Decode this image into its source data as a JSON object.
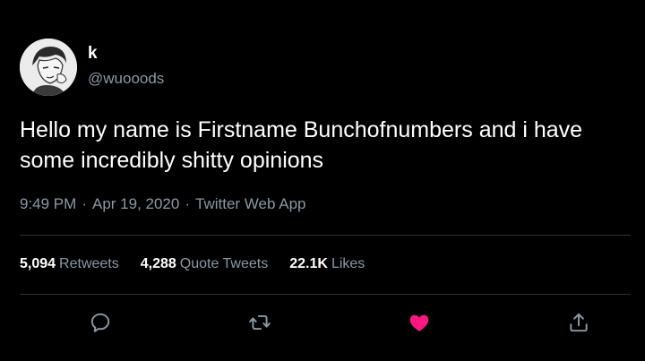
{
  "user": {
    "display_name": "k",
    "handle": "@wuooods"
  },
  "tweet": {
    "text": "Hello my name is Firstname Bunchofnumbers and i have some incredibly shitty opinions",
    "time": "9:49 PM",
    "date": "Apr 19, 2020",
    "source": "Twitter Web App",
    "separator": "·"
  },
  "stats": {
    "retweets_count": "5,094",
    "retweets_label": "Retweets",
    "quotes_count": "4,288",
    "quotes_label": "Quote Tweets",
    "likes_count": "22.1K",
    "likes_label": "Likes"
  },
  "actions": [
    {
      "icon": "reply-icon"
    },
    {
      "icon": "retweet-icon"
    },
    {
      "icon": "heart-icon",
      "liked": true
    },
    {
      "icon": "share-icon"
    }
  ],
  "colors": {
    "background": "#000000",
    "text": "#ffffff",
    "secondary_text": "#8b98a5",
    "divider": "#2f3336",
    "like_active": "#f91880"
  }
}
